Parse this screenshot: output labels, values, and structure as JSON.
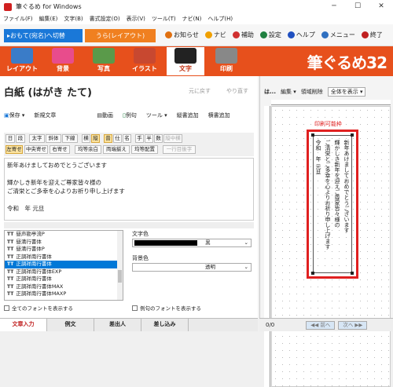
{
  "window": {
    "title": "筆ぐるめ for Windows",
    "controls": [
      "─",
      "☐",
      "✕"
    ]
  },
  "menu": [
    "ファイル(F)",
    "編集(E)",
    "文字(B)",
    "書式設定(O)",
    "表示(V)",
    "ツール(T)",
    "ナビ(N)",
    "ヘルプ(H)"
  ],
  "toolbar": {
    "omote_tab": "▸おもて(宛名)へ切替",
    "ura_tab": "うら(レイアウト)",
    "links": [
      {
        "label": "お知らせ",
        "color": "#e07010"
      },
      {
        "label": "ナビ",
        "color": "#f0a000"
      },
      {
        "label": "補助",
        "color": "#d03030"
      },
      {
        "label": "設定",
        "color": "#208040"
      },
      {
        "label": "ヘルプ",
        "color": "#2050c0"
      },
      {
        "label": "メニュー",
        "color": "#3070c0"
      },
      {
        "label": "終了",
        "color": "#c02020"
      }
    ]
  },
  "ribbon": {
    "items": [
      {
        "label": "レイアウト",
        "color": "#3a7cc8"
      },
      {
        "label": "背景",
        "color": "#e84c8c"
      },
      {
        "label": "写真",
        "color": "#5a9a4a"
      },
      {
        "label": "イラスト",
        "color": "#c84830"
      },
      {
        "label": "文字",
        "color": "#222222"
      },
      {
        "label": "印刷",
        "color": "#888888"
      }
    ],
    "active": "文字",
    "brand": "筆ぐるめ32"
  },
  "left": {
    "heading": "白紙 (はがき たて)",
    "undo": "元に戻す",
    "redo": "やり直す",
    "actions": [
      "保存 ▾",
      "新規文章"
    ],
    "actions_right": [
      "動画",
      "例句",
      "ツール ▾",
      "縦書追加",
      "横書追加"
    ],
    "format_row1": [
      "日",
      "段",
      "太字",
      "斜体",
      "下線",
      "横",
      "縦",
      "普",
      "仕",
      "名",
      "手",
      "半",
      "数",
      "縦中横"
    ],
    "format_row2": [
      "左寄せ",
      "中央寄せ",
      "右寄せ",
      "均等余白",
      "両端揃え",
      "均等配置",
      "一行目後字"
    ],
    "editor_text": "新年あけましておめでとうございます\n\n輝かしき新年を迎えご尊家皆々様の\nご清栄とご多幸を心よりお祈り申し上げます\n\n令和　年 元旦",
    "fonts": [
      "昼声勘亭流P",
      "昼満行書体",
      "昼満行書体P",
      "正調祥南行書体",
      "正調祥南行書体",
      "正調祥南行書体EXP",
      "正調祥南行書体",
      "正調祥南行書体MAX",
      "正調祥南行書体MAXP"
    ],
    "selected_font_index": 4,
    "text_color_label": "文字色",
    "text_color_value": "黒",
    "bg_color_label": "背景色",
    "bg_color_value": "透明",
    "show_all_fonts": "全てのフォントを表示する",
    "show_example_fonts": "例句のフォントを表示する",
    "bottom_tabs": [
      "文章入力",
      "例文",
      "差出人",
      "差し込み"
    ],
    "active_tab": "文章入力"
  },
  "right": {
    "toolbar": [
      "は...",
      "編集 ▾",
      "領域削除",
      "全体を表示 ▾"
    ],
    "printable_label": "印刷可能枠",
    "card_lines": [
      "新年あけましておめでとうございます",
      "輝かしき新年を迎えご尊家皆々様の",
      "ご清栄とご多幸を心よりお祈り申し上げます",
      "令和　年 元旦"
    ],
    "page_counter": "0/0",
    "prev": "◀◀ 前へ",
    "next": "次へ ▶▶"
  }
}
